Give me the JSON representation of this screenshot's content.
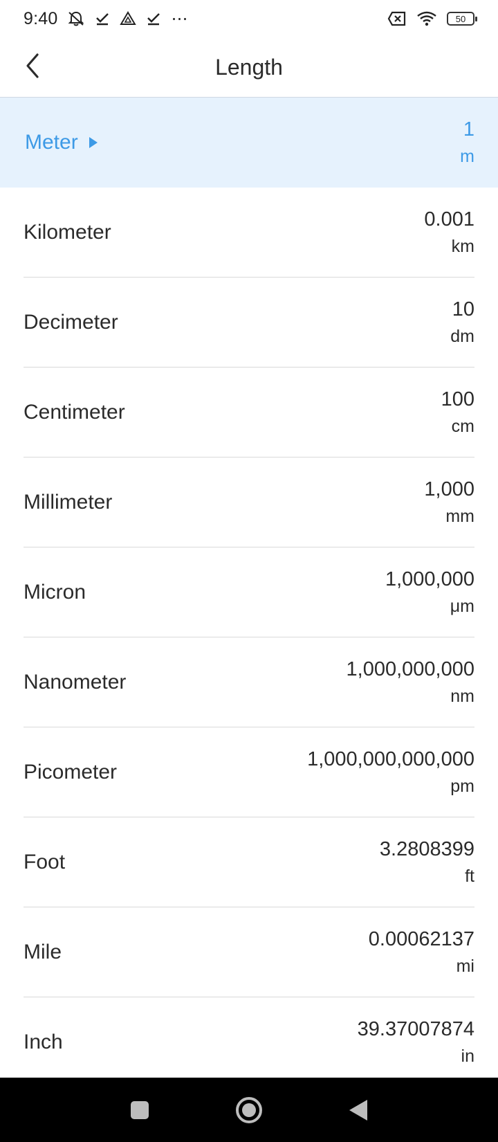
{
  "status_bar": {
    "time": "9:40",
    "left_icons": [
      "mute-notifications-icon",
      "check-icon",
      "drive-icon",
      "check-icon",
      "more-dots-icon"
    ],
    "more_dots": "⋯",
    "battery": "50"
  },
  "app_bar": {
    "title": "Length",
    "back_icon": "chevron-left-icon"
  },
  "units": [
    {
      "name": "Meter",
      "value": "1",
      "symbol": "m",
      "selected": true
    },
    {
      "name": "Kilometer",
      "value": "0.001",
      "symbol": "km"
    },
    {
      "name": "Decimeter",
      "value": "10",
      "symbol": "dm"
    },
    {
      "name": "Centimeter",
      "value": "100",
      "symbol": "cm"
    },
    {
      "name": "Millimeter",
      "value": "1,000",
      "symbol": "mm"
    },
    {
      "name": "Micron",
      "value": "1,000,000",
      "symbol": "μm"
    },
    {
      "name": "Nanometer",
      "value": "1,000,000,000",
      "symbol": "nm"
    },
    {
      "name": "Picometer",
      "value": "1,000,000,000,000",
      "symbol": "pm"
    },
    {
      "name": "Foot",
      "value": "3.2808399",
      "symbol": "ft"
    },
    {
      "name": "Mile",
      "value": "0.00062137",
      "symbol": "mi"
    },
    {
      "name": "Inch",
      "value": "39.37007874",
      "symbol": "in"
    }
  ],
  "nav_bar": {
    "buttons": [
      "recents-square-icon",
      "home-circle-icon",
      "back-triangle-icon"
    ]
  },
  "colors": {
    "accent": "#3d9ae6",
    "selected_bg": "#e6f2fd",
    "nav_bg": "#000000"
  }
}
